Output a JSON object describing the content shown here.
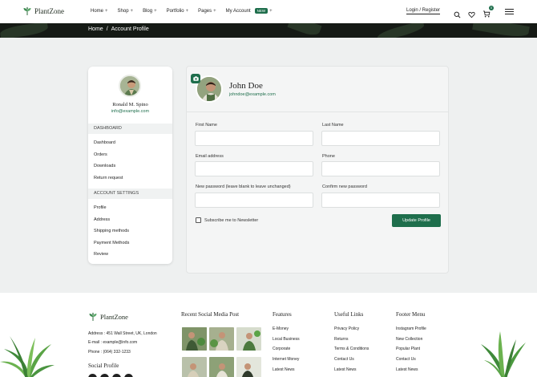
{
  "header": {
    "logo_text": "PlantZone",
    "nav": [
      {
        "label": "Home"
      },
      {
        "label": "Shop"
      },
      {
        "label": "Blog"
      },
      {
        "label": "Portfolio"
      },
      {
        "label": "Pages"
      },
      {
        "label": "My Account",
        "badge": "NEW"
      }
    ],
    "login_label": "Login / Register",
    "cart_count": "0"
  },
  "breadcrumb": {
    "home": "Home",
    "separator": "/",
    "current": "Account Profile"
  },
  "sidebar": {
    "user_name": "Ronald M. Spino",
    "user_email": "info@example.com",
    "dashboard_title": "DASHBOARD",
    "dashboard_items": [
      "Dashboard",
      "Orders",
      "Downloads",
      "Return request"
    ],
    "settings_title": "ACCOUNT SETTINGS",
    "settings_items": [
      "Profile",
      "Address",
      "Shipping methods",
      "Payment Methods",
      "Review"
    ]
  },
  "profile": {
    "name": "John Doe",
    "email": "johndoe@example.com",
    "fields": {
      "first_name_label": "First Name",
      "last_name_label": "Last Name",
      "email_label": "Email address",
      "phone_label": "Phone",
      "new_password_label": "New password (leave blank to leave unchanged)",
      "confirm_password_label": "Confirm new password"
    },
    "newsletter_label": "Subscribe me to Newsletter",
    "update_button": "Update Profile"
  },
  "footer": {
    "logo_text": "PlantZone",
    "address": "Address : 451 Wall Street, UK, London",
    "email": "E-mail : example@info.com",
    "phone": "Phone : (064) 332-1233",
    "social_title": "Social Profile",
    "recent_title": "Recent Social Media Post",
    "columns": [
      {
        "title": "Features",
        "links": [
          "E-Money",
          "Local Business",
          "Corporate",
          "Internet Money",
          "Latest News"
        ]
      },
      {
        "title": "Useful Links",
        "links": [
          "Privacy Policy",
          "Returns",
          "Terms & Conditions",
          "Contact Us",
          "Latest News"
        ]
      },
      {
        "title": "Footer Menu",
        "links": [
          "Instagram Profile",
          "New Collection",
          "Popular Plant",
          "Contact Us",
          "Latest News"
        ]
      }
    ]
  },
  "colors": {
    "brand_green": "#1e6e4c",
    "band_dark": "#151a15",
    "main_bg": "#eef0f0"
  }
}
